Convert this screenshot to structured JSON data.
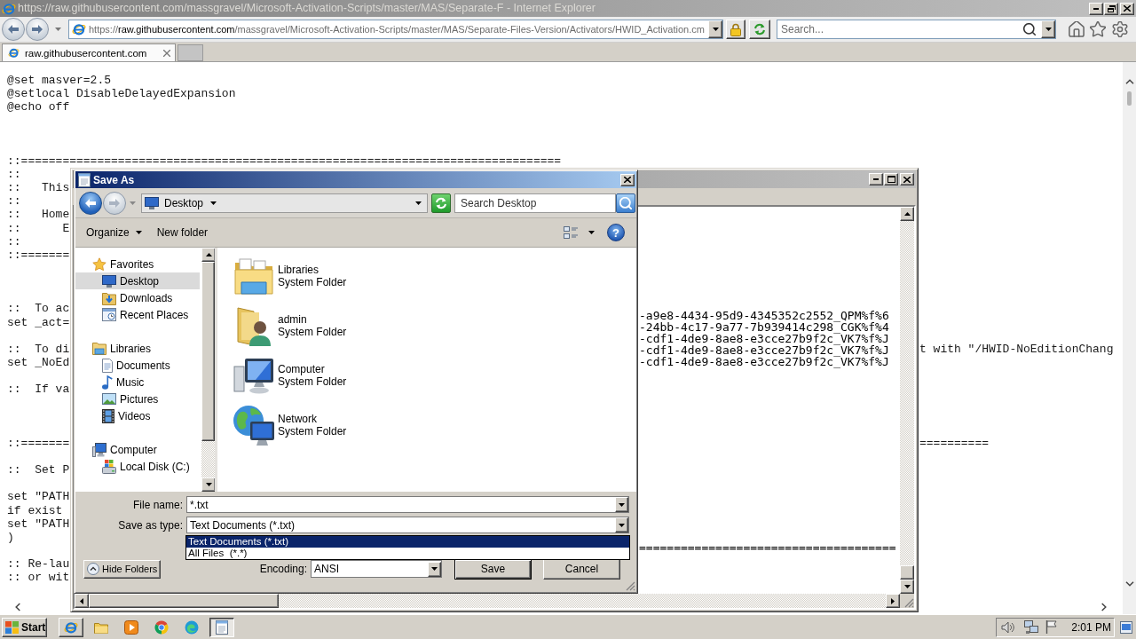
{
  "browser": {
    "title": "https://raw.githubusercontent.com/massgravel/Microsoft-Activation-Scripts/master/MAS/Separate-F - Internet Explorer",
    "address": {
      "scheme": "https://",
      "domain": "raw.githubusercontent.com",
      "path": "/massgravel/Microsoft-Activation-Scripts/master/MAS/Separate-Files-Version/Activators/HWID_Activation.cm"
    },
    "search": {
      "placeholder": "Search..."
    },
    "tabs": [
      {
        "label": "raw.githubusercontent.com",
        "selected": true
      }
    ]
  },
  "page": {
    "lines": [
      {
        "kind": "code",
        "text": "@set masver=2.5"
      },
      {
        "kind": "code",
        "text": "@setlocal DisableDelayedExpansion"
      },
      {
        "kind": "code",
        "text": "@echo off"
      },
      {
        "kind": "blank"
      },
      {
        "kind": "blank"
      },
      {
        "kind": "blank"
      },
      {
        "kind": "code",
        "text": "::=============================================================================="
      },
      {
        "kind": "code",
        "text": "::"
      },
      {
        "kind": "code",
        "text": "::   This"
      },
      {
        "kind": "code",
        "text": "::"
      },
      {
        "kind": "code",
        "text": "::   Home"
      },
      {
        "kind": "code",
        "text": "::      E"
      },
      {
        "kind": "code",
        "text": "::"
      },
      {
        "kind": "code",
        "text": "::======="
      },
      {
        "kind": "blank"
      },
      {
        "kind": "blank"
      },
      {
        "kind": "blank"
      },
      {
        "kind": "code",
        "text": "::  To ac"
      },
      {
        "kind": "code",
        "text": "set _act="
      },
      {
        "kind": "blank"
      },
      {
        "kind": "code",
        "text": "::  To di",
        "tail": "t with \"/HWID-NoEditionChang"
      },
      {
        "kind": "code",
        "text": "set _NoEd"
      },
      {
        "kind": "blank"
      },
      {
        "kind": "code",
        "text": "::  If va"
      },
      {
        "kind": "blank"
      },
      {
        "kind": "blank"
      },
      {
        "kind": "blank"
      },
      {
        "kind": "code",
        "text": "::=======",
        "tail": "=========="
      },
      {
        "kind": "blank"
      },
      {
        "kind": "code",
        "text": "::  Set P"
      },
      {
        "kind": "blank"
      },
      {
        "kind": "code",
        "text": "set \"PATH"
      },
      {
        "kind": "code",
        "text": "if exist"
      },
      {
        "kind": "code",
        "text": "set \"PATH"
      },
      {
        "kind": "code",
        "text": ")"
      },
      {
        "kind": "blank"
      },
      {
        "kind": "code",
        "text": ":: Re-lau"
      },
      {
        "kind": "code",
        "text": ":: or wit"
      }
    ]
  },
  "notepad": {
    "lines": [
      "-a9e8-4434-95d9-4345352c2552_QPM%f%6",
      "-24bb-4c17-9a77-7b939414c298_CGK%f%4",
      "-cdf1-4de9-8ae8-e3cce27b9f2c_VK7%f%J",
      "-cdf1-4de9-8ae8-e3cce27b9f2c_VK7%f%J",
      "-cdf1-4de9-8ae8-e3cce27b9f2c_VK7%f%J"
    ],
    "rule": "====================================="
  },
  "dialog": {
    "title": "Save As",
    "location": "Desktop",
    "search": {
      "placeholder": "Search Desktop"
    },
    "toolbar": [
      {
        "label": "Organize",
        "menu": true
      },
      {
        "label": "New folder",
        "menu": false
      }
    ],
    "help": "?",
    "tree": [
      {
        "label": "Favorites",
        "kind": "favorites",
        "selected": false,
        "children": [
          {
            "label": "Desktop",
            "kind": "desktop",
            "selected": true
          },
          {
            "label": "Downloads",
            "kind": "downloads",
            "selected": false
          },
          {
            "label": "Recent Places",
            "kind": "recent",
            "selected": false
          }
        ]
      },
      {
        "label": "Libraries",
        "kind": "libraries",
        "selected": false,
        "children": [
          {
            "label": "Documents",
            "kind": "documents",
            "selected": false
          },
          {
            "label": "Music",
            "kind": "music",
            "selected": false
          },
          {
            "label": "Pictures",
            "kind": "pictures",
            "selected": false
          },
          {
            "label": "Videos",
            "kind": "videos",
            "selected": false
          }
        ]
      },
      {
        "label": "Computer",
        "kind": "computer",
        "selected": false,
        "children": [
          {
            "label": "Local Disk (C:)",
            "kind": "disk",
            "selected": false
          }
        ]
      }
    ],
    "items": [
      {
        "name": "Libraries",
        "type": "System Folder",
        "kind": "libraries"
      },
      {
        "name": "admin",
        "type": "System Folder",
        "kind": "user"
      },
      {
        "name": "Computer",
        "type": "System Folder",
        "kind": "computer"
      },
      {
        "name": "Network",
        "type": "System Folder",
        "kind": "network"
      }
    ],
    "file_name": {
      "label": "File name:",
      "value": "*.txt"
    },
    "save_type": {
      "label": "Save as type:",
      "value": "Text Documents (*.txt)",
      "expanded": true,
      "options": [
        {
          "label": "Text Documents (*.txt)",
          "selected": true
        },
        {
          "label": "All Files  (*.*)",
          "selected": false
        }
      ]
    },
    "hide_folders": "Hide Folders",
    "encoding": {
      "label": "Encoding:",
      "value": "ANSI"
    },
    "buttons": [
      {
        "label": "Save",
        "default": true
      },
      {
        "label": "Cancel",
        "default": false
      }
    ]
  },
  "taskbar": {
    "start": "Start",
    "apps": [
      {
        "kind": "browser",
        "running": true,
        "selected": false
      },
      {
        "kind": "folder",
        "running": false,
        "selected": false
      },
      {
        "kind": "media",
        "running": false,
        "selected": false
      },
      {
        "kind": "chrome",
        "running": false,
        "selected": false
      },
      {
        "kind": "edge",
        "running": false,
        "selected": false
      },
      {
        "kind": "notepad",
        "running": true,
        "selected": true
      }
    ],
    "time": "2:01 PM"
  }
}
